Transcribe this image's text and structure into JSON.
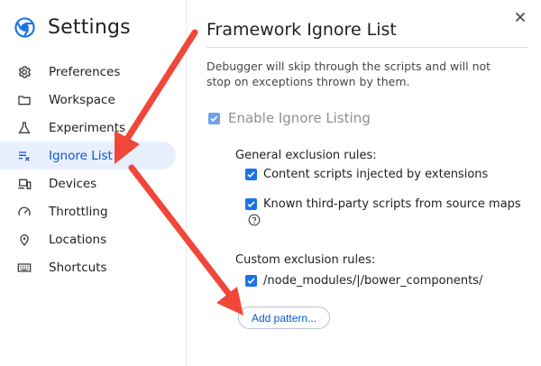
{
  "sidebar": {
    "title": "Settings",
    "items": [
      {
        "label": "Preferences",
        "icon": "gear-icon"
      },
      {
        "label": "Workspace",
        "icon": "folder-icon"
      },
      {
        "label": "Experiments",
        "icon": "flask-icon"
      },
      {
        "label": "Ignore List",
        "icon": "ignore-list-icon",
        "active": true
      },
      {
        "label": "Devices",
        "icon": "devices-icon"
      },
      {
        "label": "Throttling",
        "icon": "speedometer-icon"
      },
      {
        "label": "Locations",
        "icon": "location-pin-icon"
      },
      {
        "label": "Shortcuts",
        "icon": "keyboard-icon"
      }
    ]
  },
  "main": {
    "title": "Framework Ignore List",
    "description": "Debugger will skip through the scripts and will not stop on exceptions thrown by them.",
    "enable_label": "Enable Ignore Listing",
    "general_label": "General exclusion rules:",
    "general_rules": [
      {
        "label": "Content scripts injected by extensions",
        "checked": true
      },
      {
        "label": "Known third-party scripts from source maps",
        "checked": true
      }
    ],
    "custom_label": "Custom exclusion rules:",
    "custom_rules": [
      {
        "label": "/node_modules/|/bower_components/",
        "checked": true
      }
    ],
    "add_pattern_label": "Add pattern..."
  },
  "colors": {
    "accent": "#1a73e8",
    "active_bg": "#e8efff",
    "annotation_arrow": "#f0473a"
  }
}
